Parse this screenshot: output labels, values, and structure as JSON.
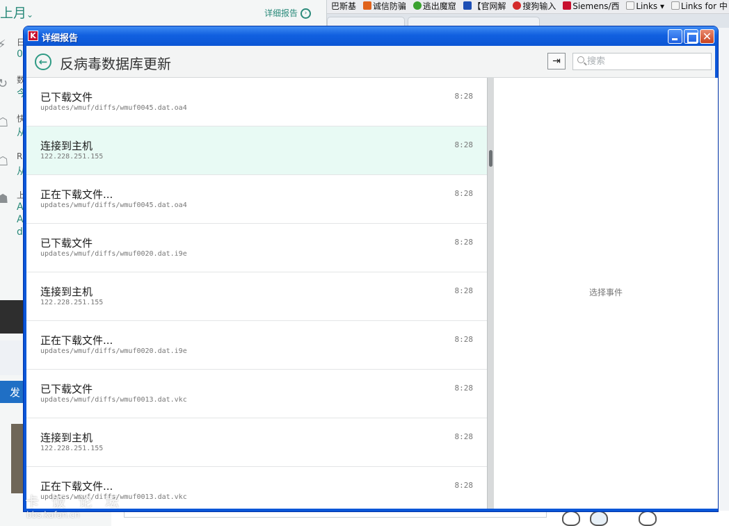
{
  "background": {
    "left_panel": {
      "month": "上月",
      "detail_link": "详细报告",
      "rows": [
        {
          "glyph": "⚡",
          "t1": "日",
          "t2": "0"
        },
        {
          "glyph": "↻",
          "t1": "数",
          "t2": "今"
        },
        {
          "glyph": "☖",
          "t1": "快",
          "t2": "从"
        },
        {
          "glyph": "☖",
          "t1": "R",
          "t2": "从"
        },
        {
          "glyph": "☗",
          "t1": "上",
          "t2": "A"
        }
      ],
      "extra_lines": [
        "A",
        "d"
      ],
      "send_button": "发"
    },
    "bookmarks": [
      {
        "label": "巴斯基",
        "color": ""
      },
      {
        "label": "诚信防骗",
        "color": "#e0621b"
      },
      {
        "label": "逃出魔窟",
        "color": "#3aa12f"
      },
      {
        "label": "【官网解",
        "color": "#1e4fb5"
      },
      {
        "label": "搜狗输入",
        "color": "#d42a2a"
      },
      {
        "label": "Siemens/西",
        "color": "#c8102e"
      },
      {
        "label": "Links ▾",
        "color": "#f5f5f5"
      },
      {
        "label": "Links for 中 ▾",
        "color": "#f5f5f5"
      }
    ],
    "watermark": "卡 饭 论 坛",
    "watermark_sub": "bbs.kafan.cn"
  },
  "window": {
    "title": "详细报告",
    "app_icon": "K",
    "controls": {
      "close_glyph": "✕"
    }
  },
  "header": {
    "back_glyph": "←",
    "title": "反病毒数据库更新",
    "export_glyph": "⇥",
    "search_placeholder": "搜索"
  },
  "events": [
    {
      "title": "已下载文件",
      "detail": "updates/wmuf/diffs/wmuf0045.dat.oa4",
      "time": "8:28",
      "selected": false
    },
    {
      "title": "连接到主机",
      "detail": "122.228.251.155",
      "time": "8:28",
      "selected": true
    },
    {
      "title": "正在下载文件...",
      "detail": "updates/wmuf/diffs/wmuf0045.dat.oa4",
      "time": "8:28",
      "selected": false
    },
    {
      "title": "已下载文件",
      "detail": "updates/wmuf/diffs/wmuf0020.dat.i9e",
      "time": "8:28",
      "selected": false
    },
    {
      "title": "连接到主机",
      "detail": "122.228.251.155",
      "time": "8:28",
      "selected": false
    },
    {
      "title": "正在下载文件...",
      "detail": "updates/wmuf/diffs/wmuf0020.dat.i9e",
      "time": "8:28",
      "selected": false
    },
    {
      "title": "已下载文件",
      "detail": "updates/wmuf/diffs/wmuf0013.dat.vkc",
      "time": "8:28",
      "selected": false
    },
    {
      "title": "连接到主机",
      "detail": "122.228.251.155",
      "time": "8:28",
      "selected": false
    },
    {
      "title": "正在下载文件...",
      "detail": "updates/wmuf/diffs/wmuf0013.dat.vkc",
      "time": "8:28",
      "selected": false
    }
  ],
  "detail_panel": {
    "empty_text": "选择事件"
  }
}
